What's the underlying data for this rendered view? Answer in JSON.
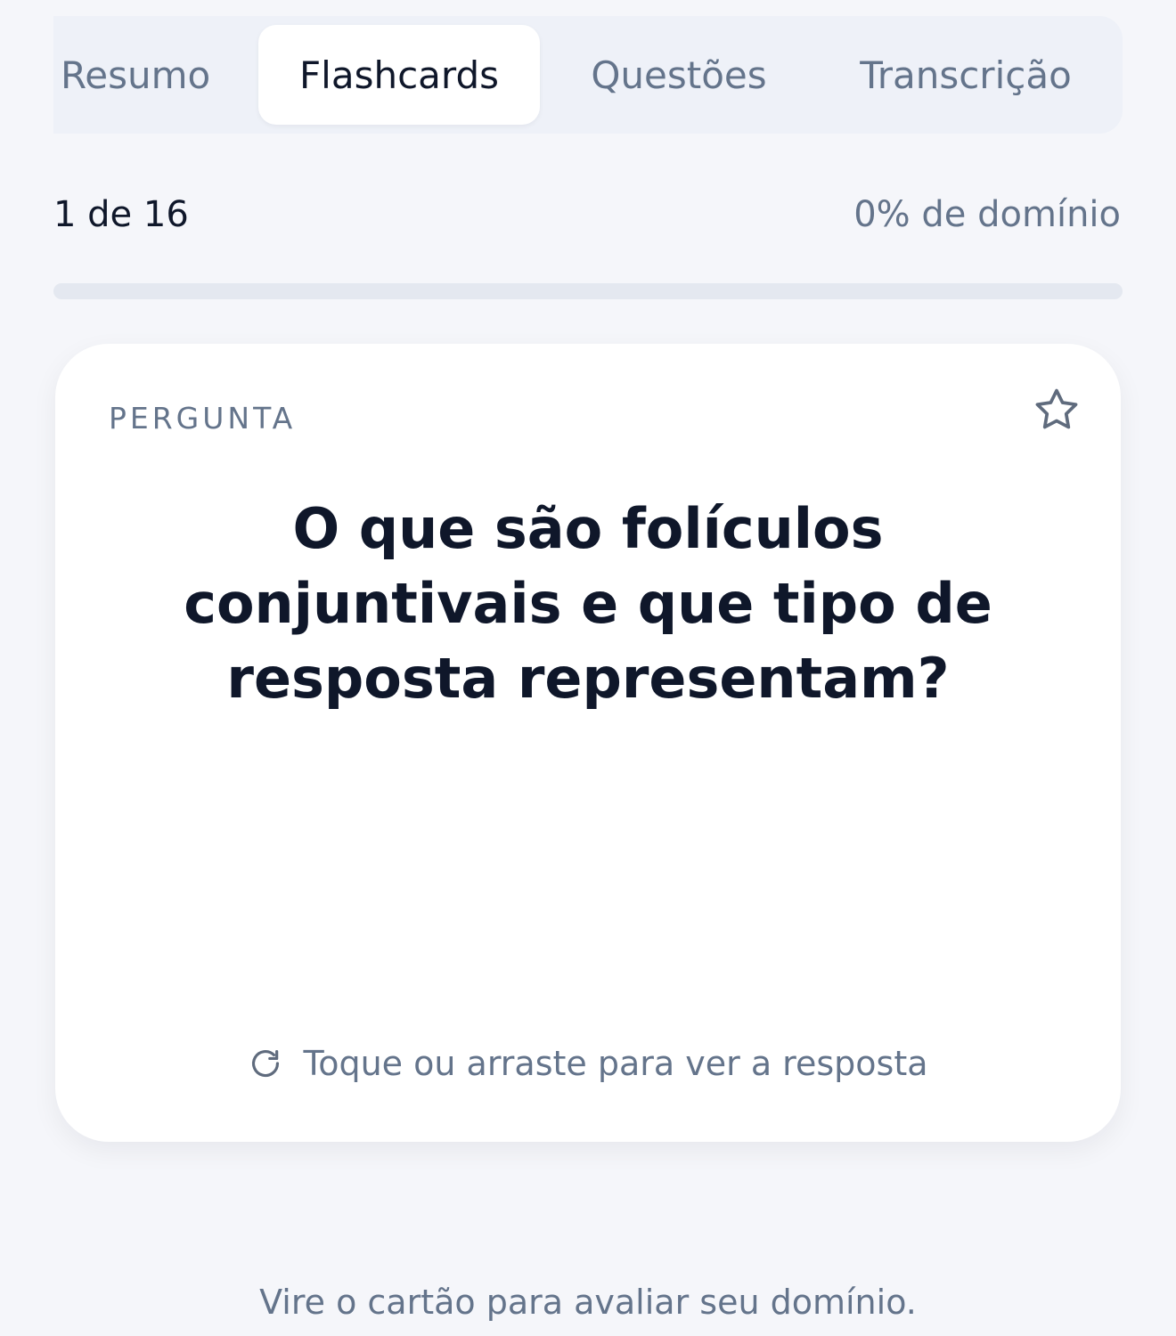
{
  "tabs": [
    {
      "label": "Resumo",
      "active": false
    },
    {
      "label": "Flashcards",
      "active": true
    },
    {
      "label": "Questões",
      "active": false
    },
    {
      "label": "Transcrição",
      "active": false
    }
  ],
  "progress": {
    "position": "1 de 16",
    "mastery": "0% de domínio",
    "mastery_fraction": 0
  },
  "card": {
    "label": "PERGUNTA",
    "question": "O que são folículos conjuntivais e que tipo de resposta representam?",
    "hint": "Toque ou arraste para ver a resposta",
    "star_icon": "star-outline-icon",
    "hint_icon": "refresh-icon"
  },
  "footer": {
    "text": "Vire o cartão para avaliar seu domínio."
  },
  "colors": {
    "background": "#f5f6fa",
    "text_primary": "#0f172a",
    "text_muted": "#64748b",
    "tab_bar": "#eef1f8",
    "card": "#ffffff",
    "progress_track": "#e4e8f0"
  }
}
